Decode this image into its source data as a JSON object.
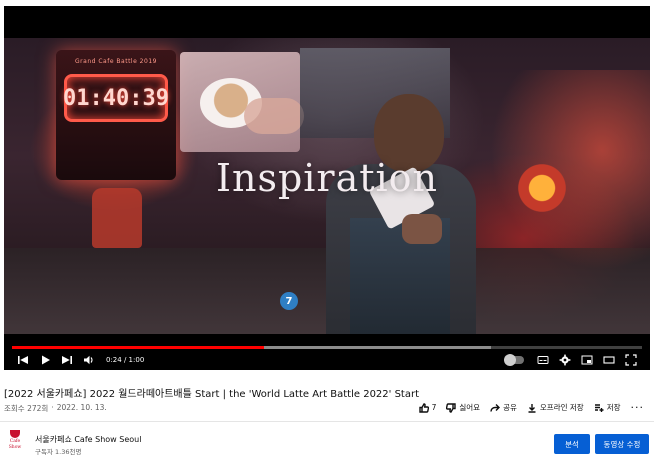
{
  "player": {
    "overlay_title": "Inspiration",
    "scene_board_header": "Grand Cafe Battle 2019",
    "scene_clock": "01:40:39",
    "scene_badge": "7",
    "current_time": "0:24",
    "time_separator": " / ",
    "duration": "1:00",
    "progress_fraction": 0.4,
    "buffer_fraction": 0.76,
    "accent_color": "#ff0000",
    "controls": {
      "prev_icon": "skip-previous-icon",
      "play_icon": "play-icon",
      "next_icon": "skip-next-icon",
      "volume_icon": "volume-icon",
      "autoplay_toggle": "autoplay-toggle",
      "subtitles_icon": "subtitles-icon",
      "settings_icon": "gear-icon",
      "miniplayer_icon": "miniplayer-icon",
      "theater_icon": "theater-icon",
      "fullscreen_icon": "fullscreen-icon"
    }
  },
  "video": {
    "title": "[2022 서울카페쇼] 2022 월드라떼아트배틀 Start | the 'World Latte Art Battle 2022' Start",
    "views": "조회수 272회",
    "dot": "·",
    "date": "2022. 10. 13."
  },
  "actions": {
    "like_count": "7",
    "dislike_label": "싫어요",
    "share_label": "공유",
    "offline_label": "오프라인 저장",
    "save_label": "저장",
    "more_label": "···"
  },
  "channel": {
    "name": "서울카페쇼 Cafe Show Seoul",
    "subscribers": "구독자 1.36천명",
    "logo_text_1": "Cafe",
    "logo_text_2": "Show",
    "brand_color": "#c8102e"
  },
  "buttons": {
    "analytics_label": "분석",
    "edit_label": "동영상 수정",
    "button_color": "#065fd4"
  }
}
